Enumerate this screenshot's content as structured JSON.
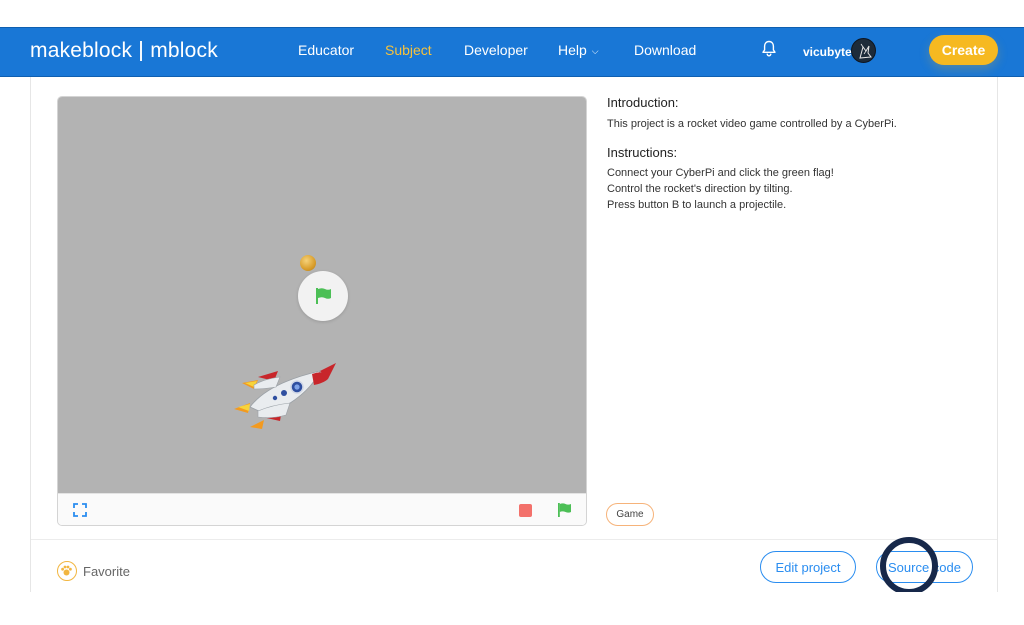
{
  "brand": {
    "left": "makeblock",
    "right": "mblock"
  },
  "nav": {
    "links": [
      {
        "label": "Educator",
        "active": false
      },
      {
        "label": "Subject",
        "active": true
      },
      {
        "label": "Developer",
        "active": false
      },
      {
        "label": "Help",
        "active": false,
        "has_dropdown": true
      },
      {
        "label": "Download",
        "active": false
      }
    ],
    "username": "vicubyte",
    "create_label": "Create"
  },
  "stage": {
    "controls": {
      "fullscreen_icon": "fullscreen-icon",
      "stop_icon": "stop-icon",
      "flag_icon": "green-flag-icon"
    }
  },
  "description": {
    "intro_title": "Introduction:",
    "intro_text": "This project is a rocket video game controlled by a CyberPi.",
    "instr_title": "Instructions:",
    "instr_lines": [
      "Connect your CyberPi and click the green flag!",
      "Control the rocket's direction by tilting.",
      "Press button B to launch a projectile."
    ]
  },
  "tags": [
    "Game"
  ],
  "footer": {
    "favorite_label": "Favorite",
    "edit_label": "Edit project",
    "source_label": "Source code"
  },
  "colors": {
    "nav_bg": "#1977d6",
    "active_link": "#f6c23c",
    "create_btn": "#f6b921",
    "outline_btn": "#2a8df0",
    "stage_bg": "#b3b3b3",
    "ring": "#17284a"
  }
}
